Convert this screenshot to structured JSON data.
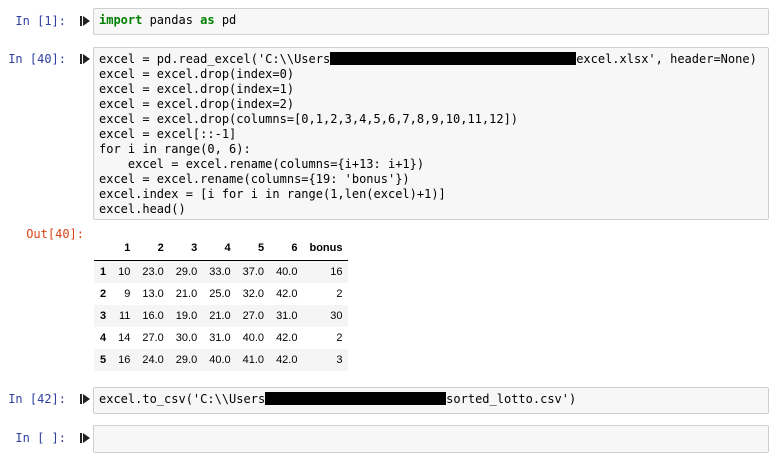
{
  "cells": [
    {
      "prompt": "In [1]:",
      "lines": [
        {
          "parts": [
            "import",
            " pandas ",
            "as",
            " pd"
          ]
        }
      ]
    },
    {
      "prompt": "In [40]:",
      "lines": [
        "excel = pd.read_excel('C:\\\\Users",
        "excel.xlsx', header=None)",
        "excel = excel.drop(index=0)",
        "excel = excel.drop(index=1)",
        "excel = excel.drop(index=2)",
        "excel = excel.drop(columns=[0,1,2,3,4,5,6,7,8,9,10,11,12])",
        "excel = excel[::-1]",
        "for i in range(0, 6):",
        "    excel = excel.rename(columns={i+13: i+1})",
        "excel = excel.rename(columns={19: 'bonus'})",
        "excel.index = [i for i in range(1,len(excel)+1)]",
        "excel.head()"
      ],
      "out_prompt": "Out[40]:"
    },
    {
      "prompt": "In [42]:",
      "lines": [
        "excel.to_csv('C:\\\\Users",
        "sorted_lotto.csv')"
      ]
    },
    {
      "prompt": "In [ ]:",
      "lines": []
    }
  ],
  "dataframe": {
    "columns": [
      "",
      "1",
      "2",
      "3",
      "4",
      "5",
      "6",
      "bonus"
    ],
    "rows": [
      [
        "1",
        "10",
        "23.0",
        "29.0",
        "33.0",
        "37.0",
        "40.0",
        "16"
      ],
      [
        "2",
        "9",
        "13.0",
        "21.0",
        "25.0",
        "32.0",
        "42.0",
        "2"
      ],
      [
        "3",
        "11",
        "16.0",
        "19.0",
        "21.0",
        "27.0",
        "31.0",
        "30"
      ],
      [
        "4",
        "14",
        "27.0",
        "30.0",
        "31.0",
        "40.0",
        "42.0",
        "2"
      ],
      [
        "5",
        "16",
        "24.0",
        "29.0",
        "40.0",
        "41.0",
        "42.0",
        "3"
      ]
    ]
  },
  "colors": {
    "in_prompt": "#303f9f",
    "out_prompt": "#d84315",
    "keyword": "#008000",
    "string": "#ba2121",
    "operator": "#aa22ff",
    "cell_bg": "#f7f7f7",
    "cell_border": "#cfcfcf"
  },
  "icons": {
    "run": "run-cell-icon"
  }
}
